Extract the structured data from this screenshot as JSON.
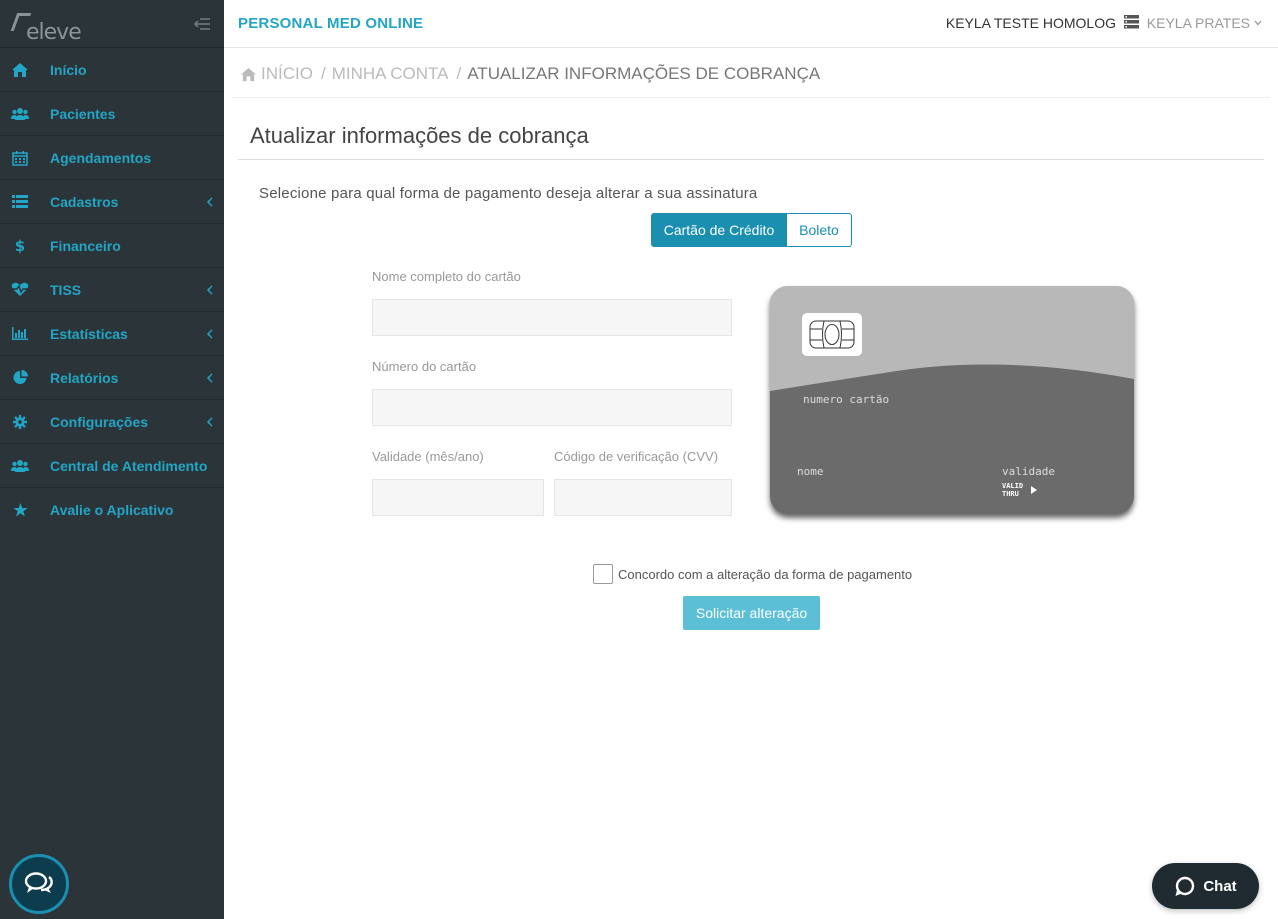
{
  "app": {
    "logo_text": "eleve",
    "brand": "PERSONAL MED ONLINE",
    "company": "KEYLA TESTE HOMOLOG",
    "user": "KEYLA PRATES"
  },
  "sidebar": {
    "items": [
      {
        "label": "Início",
        "icon": "home-icon",
        "has_submenu": false
      },
      {
        "label": "Pacientes",
        "icon": "users-icon",
        "has_submenu": false
      },
      {
        "label": "Agendamentos",
        "icon": "calendar-icon",
        "has_submenu": false
      },
      {
        "label": "Cadastros",
        "icon": "list-icon",
        "has_submenu": true
      },
      {
        "label": "Financeiro",
        "icon": "dollar-icon",
        "has_submenu": false
      },
      {
        "label": "TISS",
        "icon": "heartbeat-icon",
        "has_submenu": true
      },
      {
        "label": "Estatísticas",
        "icon": "bar-chart-icon",
        "has_submenu": true
      },
      {
        "label": "Relatórios",
        "icon": "pie-chart-icon",
        "has_submenu": true
      },
      {
        "label": "Configurações",
        "icon": "gear-icon",
        "has_submenu": true
      },
      {
        "label": "Central de Atendimento",
        "icon": "users-icon",
        "has_submenu": false
      },
      {
        "label": "Avalie o Aplicativo",
        "icon": "star-icon",
        "has_submenu": false
      }
    ]
  },
  "breadcrumb": {
    "home": "INÍCIO",
    "section": "MINHA CONTA",
    "current": "ATUALIZAR INFORMAÇÕES DE COBRANÇA"
  },
  "page": {
    "title": "Atualizar informações de cobrança",
    "instructions": "Selecione para qual forma de pagamento deseja alterar a sua assinatura"
  },
  "payment_toggle": {
    "credit_card": "Cartão de Crédito",
    "boleto": "Boleto",
    "selected": "Cartão de Crédito"
  },
  "form": {
    "name_label": "Nome completo do cartão",
    "name_value": "",
    "number_label": "Número do cartão",
    "number_value": "",
    "validity_label": "Validade (mês/ano)",
    "validity_value": "",
    "cvv_label": "Código de verificação (CVV)",
    "cvv_value": ""
  },
  "card_preview": {
    "number": "numero cartão",
    "name": "nome",
    "validity": "validade",
    "valid_thru_line1": "VALID",
    "valid_thru_line2": "THRU"
  },
  "agreement": {
    "label": "Concordo com a alteração da forma de pagamento",
    "checked": false
  },
  "submit_label": "Solicitar alteração",
  "chat_widget": {
    "label": "Chat"
  },
  "colors": {
    "sidebar_bg": "#2b3539",
    "accent": "#23a5c5",
    "primary_button": "#1a8fb0",
    "submit_button": "#5bbfd6"
  }
}
